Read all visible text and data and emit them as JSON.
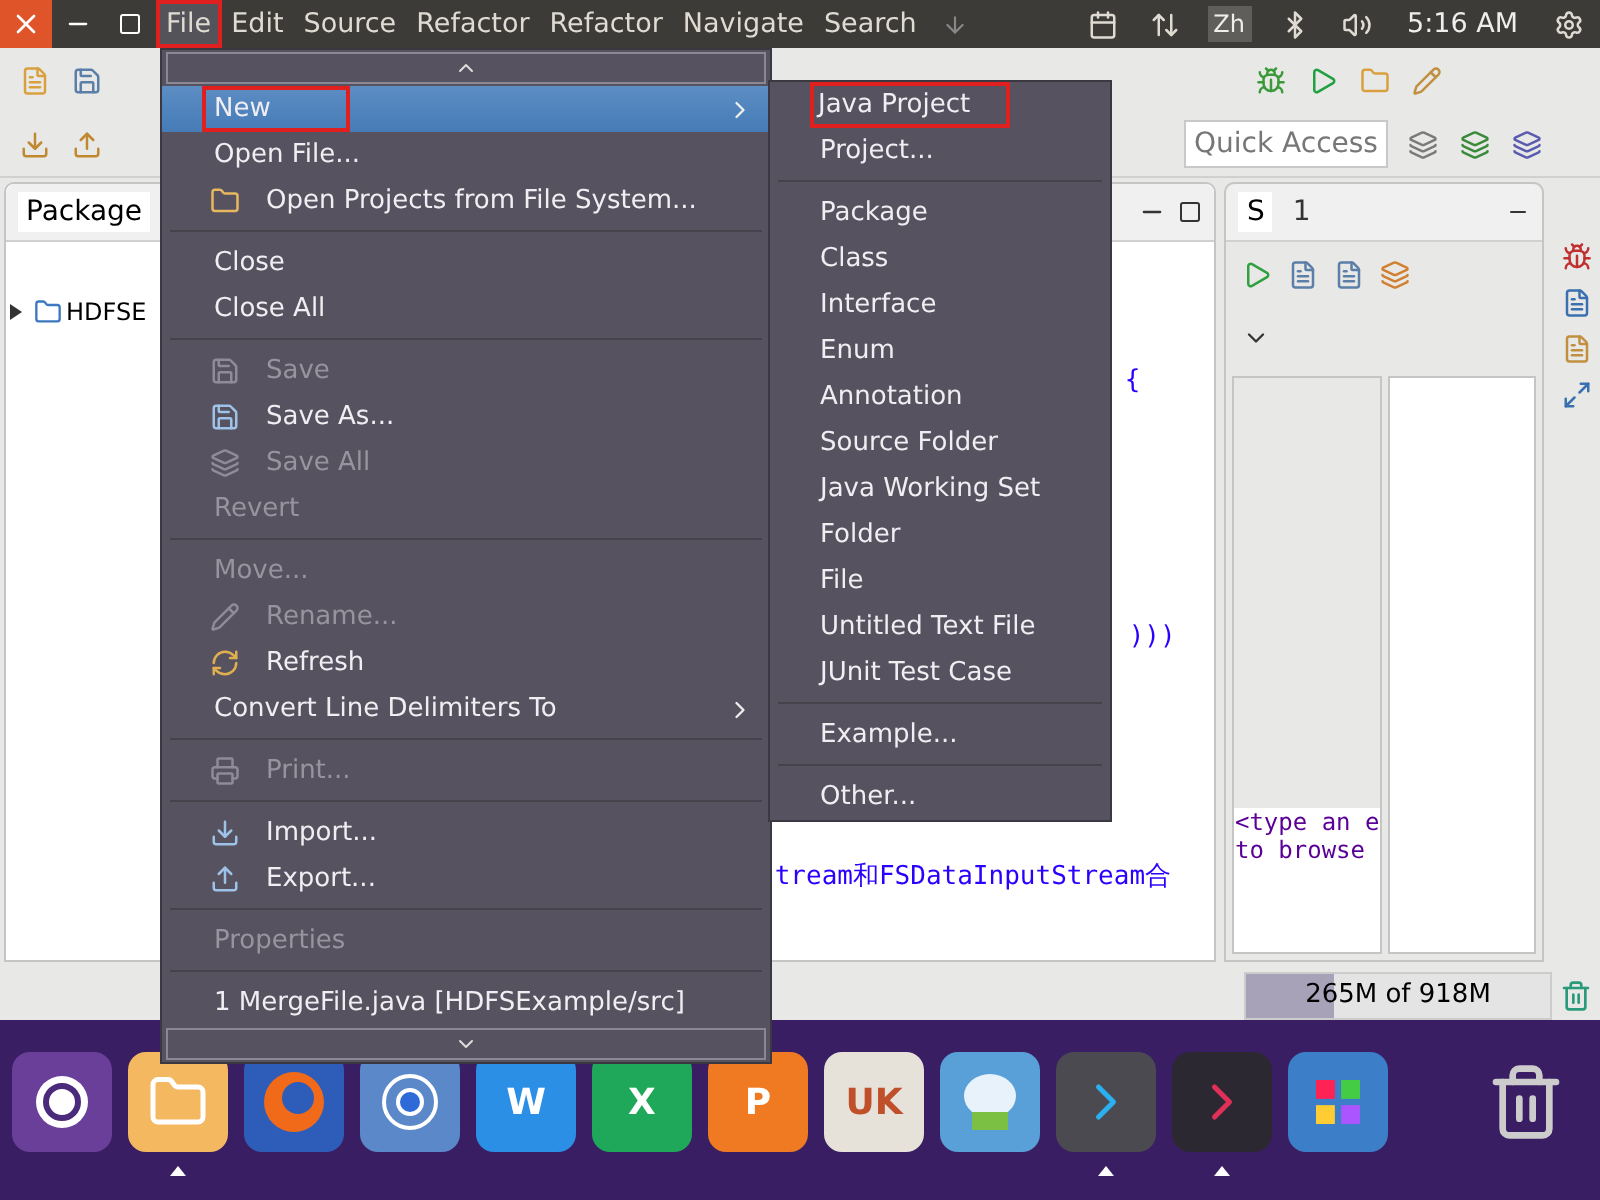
{
  "top_bar": {
    "menus": [
      {
        "label": "File",
        "selected": true,
        "highlighted": true
      },
      {
        "label": "Edit",
        "selected": false,
        "highlighted": false
      },
      {
        "label": "Source",
        "selected": false,
        "highlighted": false
      },
      {
        "label": "Refactor",
        "selected": false,
        "highlighted": false
      },
      {
        "label": "Refactor",
        "selected": false,
        "highlighted": false
      },
      {
        "label": "Navigate",
        "selected": false,
        "highlighted": false
      },
      {
        "label": "Search",
        "selected": false,
        "highlighted": false
      }
    ],
    "keyboard": "Zh",
    "clock": "5:16 AM"
  },
  "toolbar": {
    "quick_access": {
      "placeholder": "Quick Access"
    }
  },
  "package_explorer": {
    "tab": "Package",
    "tree": [
      {
        "label": "HDFSE",
        "expanded": false
      }
    ]
  },
  "editor": {
    "code_lines": [
      "{",
      ")))",
      "tream和FSDataInputStream合"
    ]
  },
  "outline_panel": {
    "tabs": [
      {
        "label": "S",
        "selected": true
      },
      {
        "label": "1",
        "selected": false
      }
    ],
    "hint_lines": [
      "<type an e",
      "to browse"
    ]
  },
  "status_bar": {
    "heap": "265M of 918M",
    "level": 0.29
  },
  "file_menu": {
    "items": [
      {
        "kind": "plain",
        "label": "New",
        "selected": true,
        "highlighted": true,
        "disabled": false,
        "submenu": true
      },
      {
        "kind": "plain",
        "label": "Open File...",
        "selected": false,
        "highlighted": false,
        "disabled": false,
        "submenu": false
      },
      {
        "kind": "folder",
        "label": "Open Projects from File System...",
        "selected": false,
        "highlighted": false,
        "disabled": false,
        "submenu": false
      },
      {
        "kind": "separator"
      },
      {
        "kind": "plain",
        "label": "Close",
        "selected": false,
        "highlighted": false,
        "disabled": false,
        "submenu": false
      },
      {
        "kind": "plain",
        "label": "Close All",
        "selected": false,
        "highlighted": false,
        "disabled": false,
        "submenu": false
      },
      {
        "kind": "separator"
      },
      {
        "kind": "save",
        "label": "Save",
        "selected": false,
        "highlighted": false,
        "disabled": true,
        "submenu": false
      },
      {
        "kind": "saveas",
        "label": "Save As...",
        "selected": false,
        "highlighted": false,
        "disabled": false,
        "submenu": false
      },
      {
        "kind": "saveall",
        "label": "Save All",
        "selected": false,
        "highlighted": false,
        "disabled": true,
        "submenu": false
      },
      {
        "kind": "plain",
        "label": "Revert",
        "selected": false,
        "highlighted": false,
        "disabled": true,
        "submenu": false
      },
      {
        "kind": "separator"
      },
      {
        "kind": "plain",
        "label": "Move...",
        "selected": false,
        "highlighted": false,
        "disabled": true,
        "submenu": false
      },
      {
        "kind": "rename",
        "label": "Rename...",
        "selected": false,
        "highlighted": false,
        "disabled": true,
        "submenu": false
      },
      {
        "kind": "refresh",
        "label": "Refresh",
        "selected": false,
        "highlighted": false,
        "disabled": false,
        "submenu": false
      },
      {
        "kind": "plain",
        "label": "Convert Line Delimiters To",
        "selected": false,
        "highlighted": false,
        "disabled": false,
        "submenu": true
      },
      {
        "kind": "separator"
      },
      {
        "kind": "print",
        "label": "Print...",
        "selected": false,
        "highlighted": false,
        "disabled": true,
        "submenu": false
      },
      {
        "kind": "separator"
      },
      {
        "kind": "import",
        "label": "Import...",
        "selected": false,
        "highlighted": false,
        "disabled": false,
        "submenu": false
      },
      {
        "kind": "export",
        "label": "Export...",
        "selected": false,
        "highlighted": false,
        "disabled": false,
        "submenu": false
      },
      {
        "kind": "separator"
      },
      {
        "kind": "plain",
        "label": "Properties",
        "selected": false,
        "highlighted": false,
        "disabled": true,
        "submenu": false
      },
      {
        "kind": "separator"
      },
      {
        "kind": "plain",
        "label": "1 MergeFile.java  [HDFSExample/src]",
        "selected": false,
        "highlighted": false,
        "disabled": false,
        "submenu": false
      }
    ]
  },
  "new_submenu": {
    "items": [
      {
        "kind": "plain",
        "label": "Java Project",
        "highlighted": true
      },
      {
        "kind": "plain",
        "label": "Project...",
        "highlighted": false
      },
      {
        "kind": "separator"
      },
      {
        "kind": "plain",
        "label": "Package",
        "highlighted": false
      },
      {
        "kind": "plain",
        "label": "Class",
        "highlighted": false
      },
      {
        "kind": "plain",
        "label": "Interface",
        "highlighted": false
      },
      {
        "kind": "plain",
        "label": "Enum",
        "highlighted": false
      },
      {
        "kind": "plain",
        "label": "Annotation",
        "highlighted": false
      },
      {
        "kind": "plain",
        "label": "Source Folder",
        "highlighted": false
      },
      {
        "kind": "plain",
        "label": "Java Working Set",
        "highlighted": false
      },
      {
        "kind": "plain",
        "label": "Folder",
        "highlighted": false
      },
      {
        "kind": "plain",
        "label": "File",
        "highlighted": false
      },
      {
        "kind": "plain",
        "label": "Untitled Text File",
        "highlighted": false
      },
      {
        "kind": "plain",
        "label": "JUnit Test Case",
        "highlighted": false
      },
      {
        "kind": "separator"
      },
      {
        "kind": "plain",
        "label": "Example...",
        "highlighted": false
      },
      {
        "kind": "separator"
      },
      {
        "kind": "plain",
        "label": "Other...",
        "highlighted": false
      }
    ]
  },
  "dock": {
    "items": [
      {
        "kind": "ubuntu",
        "running": false
      },
      {
        "kind": "files",
        "running": true
      },
      {
        "kind": "firefox",
        "running": false
      },
      {
        "kind": "browser",
        "running": false
      },
      {
        "kind": "word",
        "label": "W",
        "running": false
      },
      {
        "kind": "excel",
        "label": "X",
        "running": false
      },
      {
        "kind": "powerpoint",
        "label": "P",
        "running": false
      },
      {
        "kind": "store",
        "label": "UK",
        "running": false
      },
      {
        "kind": "robot",
        "running": false
      },
      {
        "kind": "code",
        "running": true
      },
      {
        "kind": "terminal",
        "running": true
      },
      {
        "kind": "apps",
        "running": false
      },
      {
        "kind": "trash",
        "running": false
      }
    ]
  }
}
